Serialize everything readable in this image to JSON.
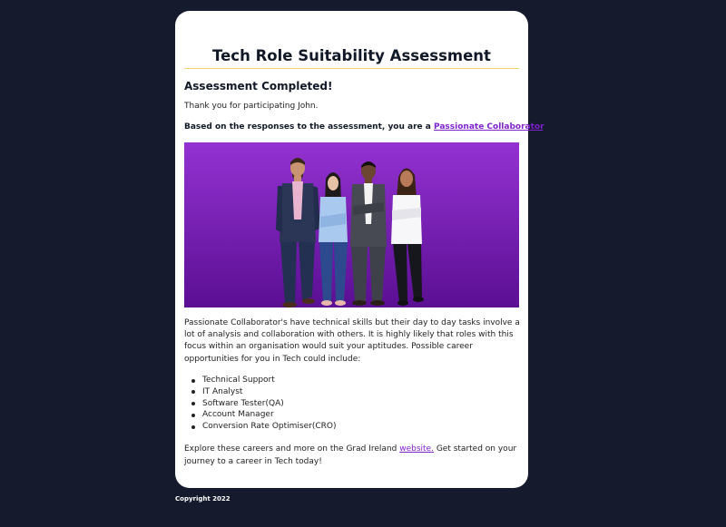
{
  "page": {
    "title": "Tech Role Suitability Assessment"
  },
  "result": {
    "heading": "Assessment Completed!",
    "thanks": "Thank you for participating John.",
    "summary_prefix": "Based on the responses to the assessment, you are a",
    "profile_name": "Passionate Collaborator",
    "summary_suffix": ".",
    "description": "Passionate Collaborator's have technical skills but their day to day tasks involve a lot of analysis and collaboration with others. It is highly likely that roles with this focus within an organisation would suit your aptitudes. Possible career opportunities for you in Tech could include:",
    "careers": [
      "Technical Support",
      "IT Analyst",
      "Software Tester(QA)",
      "Account Manager",
      "Conversion Rate Optimiser(CRO)"
    ],
    "explore_prefix": "Explore these careers and more on the Grad Ireland",
    "explore_link": "website.",
    "explore_suffix": " Get started on your journey to a career in Tech today!"
  },
  "hero": {
    "icon": "team-illustration",
    "gradient_top": "#8f2fcc",
    "gradient_bottom": "#5a0f8f"
  },
  "footer": {
    "copyright": "Copyright 2022"
  },
  "colors": {
    "background": "#151a2d",
    "accent": "#7e22ce",
    "divider": "#f0d46a"
  }
}
